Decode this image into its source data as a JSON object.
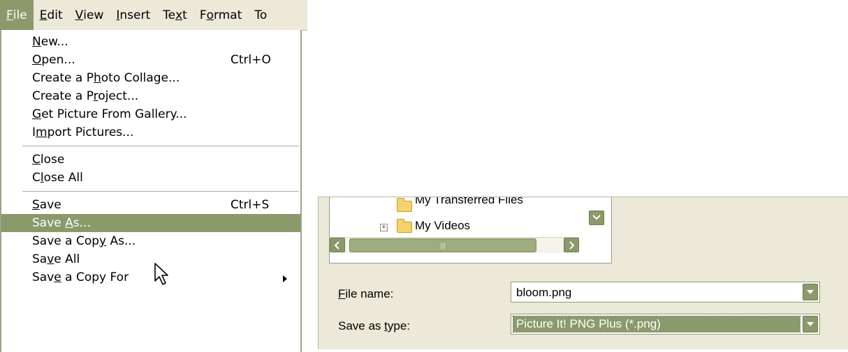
{
  "menubar": {
    "items": [
      {
        "text": "File",
        "u": "F",
        "rest": "ile",
        "pre": ""
      },
      {
        "text": "Edit",
        "u": "E",
        "rest": "dit",
        "pre": ""
      },
      {
        "text": "View",
        "u": "V",
        "rest": "iew",
        "pre": ""
      },
      {
        "text": "Insert",
        "u": "I",
        "rest": "nsert",
        "pre": ""
      },
      {
        "text": "Text",
        "pre": "Te",
        "u": "x",
        "rest": "t"
      },
      {
        "text": "Format",
        "pre": "F",
        "u": "o",
        "rest": "rmat"
      },
      {
        "text": "To",
        "pre": "To",
        "u": "",
        "rest": ""
      }
    ]
  },
  "file_menu": {
    "new": {
      "pre": "",
      "u": "N",
      "post": "ew..."
    },
    "open": {
      "pre": "",
      "u": "O",
      "post": "pen...",
      "shortcut": "Ctrl+O"
    },
    "photo_collage": {
      "pre": "Create a P",
      "u": "h",
      "post": "oto Collage..."
    },
    "project": {
      "pre": "Create a P",
      "u": "r",
      "post": "oject..."
    },
    "gallery": {
      "pre": "",
      "u": "G",
      "post": "et Picture From Gallery..."
    },
    "import": {
      "pre": "I",
      "u": "m",
      "post": "port Pictures..."
    },
    "close": {
      "pre": "",
      "u": "C",
      "post": "lose"
    },
    "close_all": {
      "pre": "C",
      "u": "l",
      "post": "ose All"
    },
    "save": {
      "pre": "",
      "u": "S",
      "post": "ave",
      "shortcut": "Ctrl+S"
    },
    "save_as": {
      "pre": "Save ",
      "u": "A",
      "post": "s..."
    },
    "save_copy_as": {
      "pre": "Save a Cop",
      "u": "y",
      "post": " As..."
    },
    "save_all": {
      "pre": "Sa",
      "u": "v",
      "post": "e All"
    },
    "save_copy_for": {
      "pre": "Sav",
      "u": "e",
      "post": " a Copy For"
    }
  },
  "dialog": {
    "tree": {
      "item1": "My Transferred Files",
      "item2": "My Videos"
    },
    "file_name": {
      "label_u": "F",
      "label_rest": "ile name:",
      "value": "bloom.png"
    },
    "save_type": {
      "label_pre": "Save as ",
      "label_u": "t",
      "label_rest": "ype:",
      "value": "Picture It! PNG Plus (*.png)"
    }
  },
  "colors": {
    "accent": "#8a9a6a",
    "dialog_bg": "#ece9d8"
  }
}
